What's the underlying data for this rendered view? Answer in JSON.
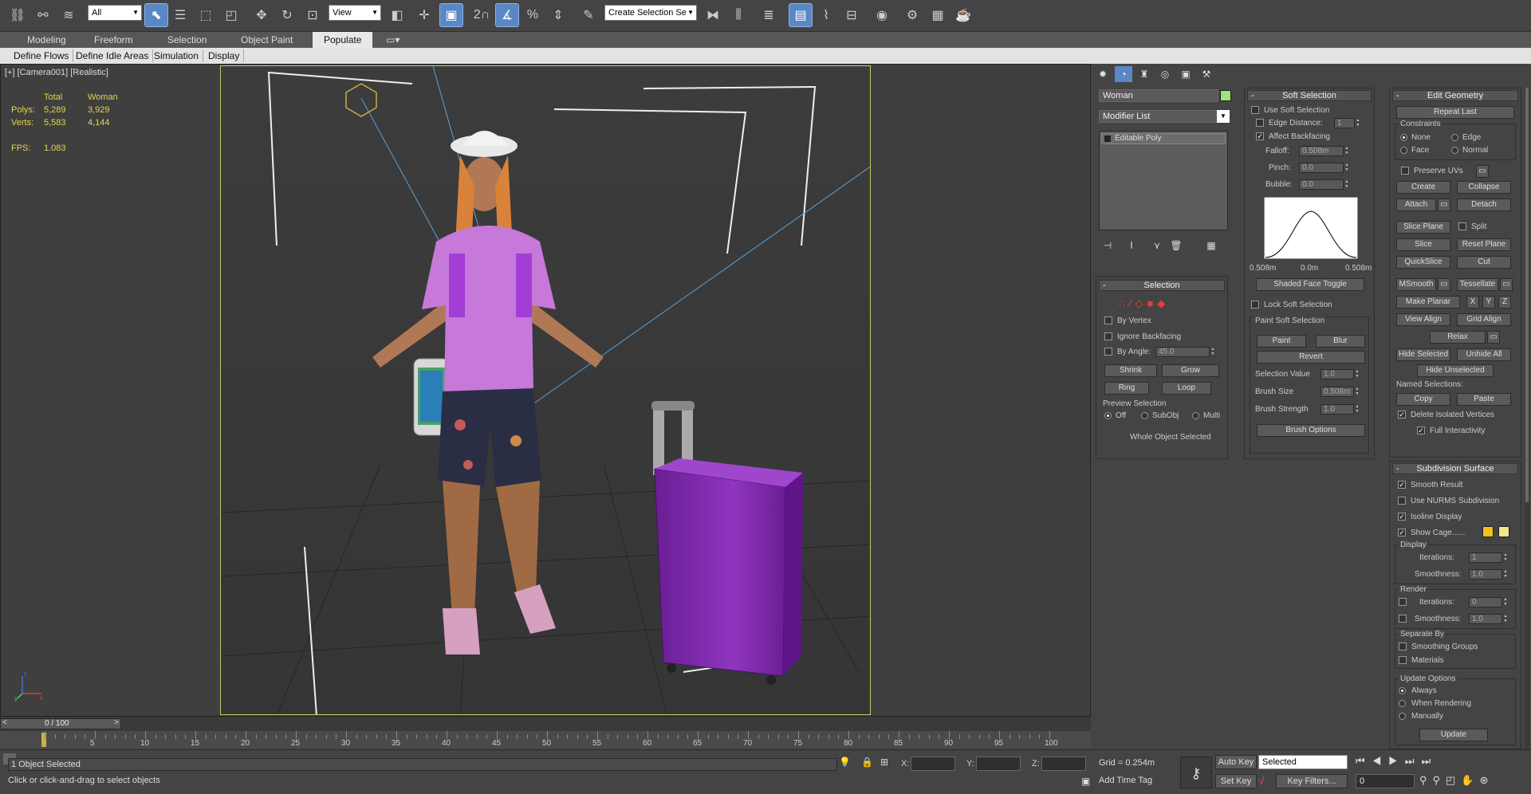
{
  "toolbar": {
    "selection_filter": "All",
    "ref_coord": "View",
    "selection_set_placeholder": "Create Selection Se",
    "snaps_label": "2",
    "percent_snap_label": "%"
  },
  "ribbon": {
    "tabs": [
      "Modeling",
      "Freeform",
      "Selection",
      "Object Paint",
      "Populate"
    ],
    "active_tab": "Populate",
    "sub_tabs": [
      "Define Flows",
      "Define Idle Areas",
      "Simulation",
      "Display"
    ]
  },
  "viewport": {
    "label": "[+] [Camera001] [Realistic]",
    "stats": {
      "col_total": "Total",
      "col_obj": "Woman",
      "polys_label": "Polys:",
      "polys_total": "5,289",
      "polys_obj": "3,929",
      "verts_label": "Verts:",
      "verts_total": "5,583",
      "verts_obj": "4,144",
      "fps_label": "FPS:",
      "fps_value": "1.083"
    },
    "axis_labels": {
      "x": "x",
      "y": "y",
      "z": "z"
    }
  },
  "command_panel": {
    "object_name": "Woman",
    "object_color": "#9fe27a",
    "modifier_list": "Modifier List",
    "stack_item": "Editable Poly",
    "selection": {
      "title": "Selection",
      "by_vertex": "By Vertex",
      "ignore_backfacing": "Ignore Backfacing",
      "by_angle": "By Angle:",
      "by_angle_value": "45.0",
      "shrink": "Shrink",
      "grow": "Grow",
      "ring": "Ring",
      "loop": "Loop",
      "preview_title": "Preview Selection",
      "preview_off": "Off",
      "preview_subobj": "SubObj",
      "preview_multi": "Multi",
      "status": "Whole Object Selected"
    },
    "soft_selection": {
      "title": "Soft Selection",
      "use_soft": "Use Soft Selection",
      "edge_distance": "Edge Distance:",
      "edge_distance_value": "1",
      "affect_backfacing": "Affect Backfacing",
      "falloff": "Falloff:",
      "falloff_value": "0.508m",
      "pinch": "Pinch:",
      "pinch_value": "0.0",
      "bubble": "Bubble:",
      "bubble_value": "0.0",
      "curve_left": "0.508m",
      "curve_mid": "0.0m",
      "curve_right": "0.508m",
      "shaded_toggle": "Shaded Face Toggle",
      "lock_soft": "Lock Soft Selection",
      "paint_title": "Paint Soft Selection",
      "paint": "Paint",
      "blur": "Blur",
      "revert": "Revert",
      "selection_value": "Selection Value",
      "selection_value_v": "1.0",
      "brush_size": "Brush Size",
      "brush_size_v": "0.508m",
      "brush_strength": "Brush Strength",
      "brush_strength_v": "1.0",
      "brush_options": "Brush Options"
    },
    "edit_geometry": {
      "title": "Edit Geometry",
      "repeat_last": "Repeat Last",
      "constraints": "Constraints",
      "c_none": "None",
      "c_edge": "Edge",
      "c_face": "Face",
      "c_normal": "Normal",
      "preserve_uvs": "Preserve UVs",
      "create": "Create",
      "collapse": "Collapse",
      "attach": "Attach",
      "detach": "Detach",
      "slice_plane": "Slice Plane",
      "split": "Split",
      "slice": "Slice",
      "reset_plane": "Reset Plane",
      "quickslice": "QuickSlice",
      "cut": "Cut",
      "msmooth": "MSmooth",
      "tessellate": "Tessellate",
      "make_planar": "Make Planar",
      "x": "X",
      "y": "Y",
      "z": "Z",
      "view_align": "View Align",
      "grid_align": "Grid Align",
      "relax": "Relax",
      "hide_selected": "Hide Selected",
      "unhide_all": "Unhide All",
      "hide_unselected": "Hide Unselected",
      "named_selections": "Named Selections:",
      "copy": "Copy",
      "paste": "Paste",
      "delete_isolated": "Delete Isolated Vertices",
      "full_interactivity": "Full Interactivity"
    },
    "subdivision": {
      "title": "Subdivision Surface",
      "smooth_result": "Smooth Result",
      "use_nurms": "Use NURMS Subdivision",
      "isoline": "Isoline Display",
      "show_cage": "Show Cage......",
      "cage_color1": "#f0c020",
      "cage_color2": "#f4e68a",
      "display": "Display",
      "iterations": "Iterations:",
      "display_iter_v": "1",
      "smoothness": "Smoothness:",
      "display_smooth_v": "1.0",
      "render": "Render",
      "render_iter_v": "0",
      "render_smooth_v": "1.0",
      "separate_by": "Separate By",
      "smoothing_groups": "Smoothing Groups",
      "materials": "Materials",
      "update_options": "Update Options",
      "always": "Always",
      "when_rendering": "When Rendering",
      "manually": "Manually",
      "update": "Update"
    }
  },
  "timeline": {
    "frame_display": "0 / 100",
    "ticks": [
      "5",
      "10",
      "15",
      "20",
      "25",
      "30",
      "35",
      "40",
      "45",
      "50",
      "55",
      "60",
      "65",
      "70",
      "75",
      "80",
      "85",
      "90",
      "95",
      "100"
    ]
  },
  "status": {
    "selected": "1 Object Selected",
    "prompt": "Click or click-and-drag to select objects",
    "x_label": "X:",
    "y_label": "Y:",
    "z_label": "Z:",
    "grid": "Grid = 0.254m",
    "add_time_tag": "Add Time Tag",
    "auto_key": "Auto Key",
    "set_key": "Set Key",
    "key_mode": "Selected",
    "key_filters": "Key Filters...",
    "current_frame": "0"
  }
}
